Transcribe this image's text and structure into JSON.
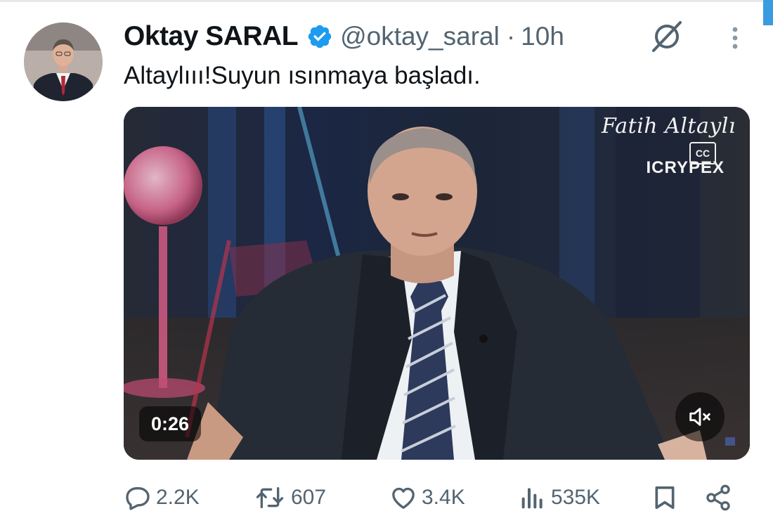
{
  "tweet": {
    "author_name": "Oktay SARAL",
    "handle": "@oktay_saral",
    "separator": "·",
    "time": "10h",
    "text": "Altaylııı!Suyun ısınmaya başladı.",
    "verified": true
  },
  "media": {
    "watermark_name": "Fatih Altaylı",
    "watermark_brand": "ICRYPEX",
    "captions_badge": "CC",
    "duration": "0:26",
    "muted": true
  },
  "actions": {
    "replies": "2.2K",
    "retweets": "607",
    "likes": "3.4K",
    "views": "535K"
  },
  "icons": {
    "verified": "verified-badge-icon",
    "grok": "grok-icon",
    "more": "more-icon",
    "reply": "reply-icon",
    "retweet": "retweet-icon",
    "like": "heart-icon",
    "views": "views-icon",
    "bookmark": "bookmark-icon",
    "share": "share-icon",
    "mute": "volume-muted-icon"
  },
  "colors": {
    "accent": "#1d9bf0",
    "text": "#0f1419",
    "secondary": "#536471"
  }
}
